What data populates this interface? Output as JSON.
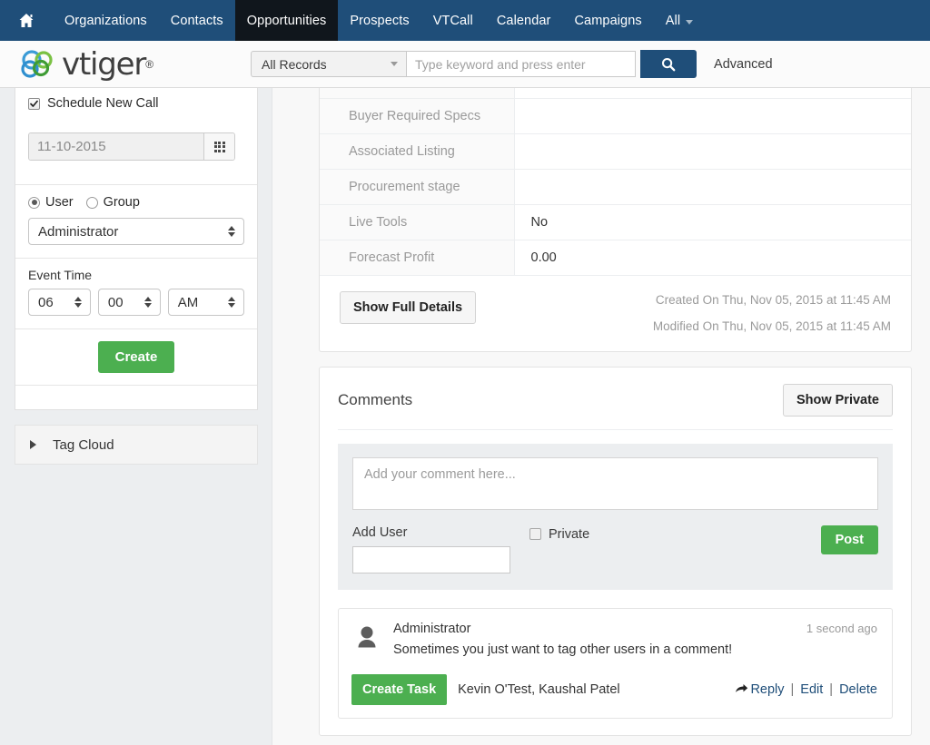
{
  "topnav": {
    "home_icon": "home-icon",
    "items": [
      {
        "label": "Organizations",
        "active": false
      },
      {
        "label": "Contacts",
        "active": false
      },
      {
        "label": "Opportunities",
        "active": true
      },
      {
        "label": "Prospects",
        "active": false
      },
      {
        "label": "VTCall",
        "active": false
      },
      {
        "label": "Calendar",
        "active": false
      },
      {
        "label": "Campaigns",
        "active": false
      },
      {
        "label": "All",
        "active": false
      }
    ],
    "bg_color": "#1f4e79",
    "active_bg_color": "#10161c"
  },
  "header": {
    "logo_text": "vtiger",
    "logo_tm": "®",
    "search": {
      "scope_value": "All Records",
      "placeholder": "Type keyword and press enter",
      "input_value": "",
      "button_icon": "search-icon",
      "advanced_label": "Advanced"
    }
  },
  "sidebar": {
    "schedule": {
      "checkbox_label": "Schedule New Call",
      "checked": true,
      "date_value": "11-10-2015",
      "calendar_icon": "calendar-icon",
      "assign_to": {
        "user_label": "User",
        "group_label": "Group",
        "selected": "user",
        "assignee": "Administrator"
      },
      "event_time_label": "Event Time",
      "hour": "06",
      "minute": "00",
      "meridiem": "AM",
      "create_label": "Create",
      "create_color": "#4caf50"
    },
    "tag_cloud": {
      "label": "Tag Cloud",
      "expand_icon": "caret-right-icon",
      "expanded": false
    }
  },
  "detail": {
    "rows": [
      {
        "label": "Buyer Required Specs",
        "value": ""
      },
      {
        "label": "Associated Listing",
        "value": ""
      },
      {
        "label": "Procurement stage",
        "value": ""
      },
      {
        "label": "Live Tools",
        "value": "No"
      },
      {
        "label": "Forecast Profit",
        "value": "0.00"
      }
    ],
    "show_full_details_label": "Show Full Details",
    "created_on": "Created On Thu, Nov 05, 2015 at 11:45 AM",
    "modified_on": "Modified On Thu, Nov 05, 2015 at 11:45 AM"
  },
  "comments": {
    "title": "Comments",
    "show_private_label": "Show Private",
    "form": {
      "placeholder": "Add your comment here...",
      "textarea_value": "",
      "add_user_label": "Add User",
      "add_user_value": "",
      "private_label": "Private",
      "private_checked": false,
      "post_label": "Post",
      "post_color": "#4caf50"
    },
    "list": [
      {
        "author": "Administrator",
        "avatar_icon": "user-avatar-icon",
        "time": "1 second ago",
        "text": "Sometimes you just want to tag other users in a comment!",
        "create_task_label": "Create Task",
        "tagged_users": "Kevin O'Test, Kaushal Patel",
        "reply_label": "Reply",
        "reply_icon": "reply-arrow-icon",
        "edit_label": "Edit",
        "delete_label": "Delete",
        "sep": "|"
      }
    ]
  }
}
